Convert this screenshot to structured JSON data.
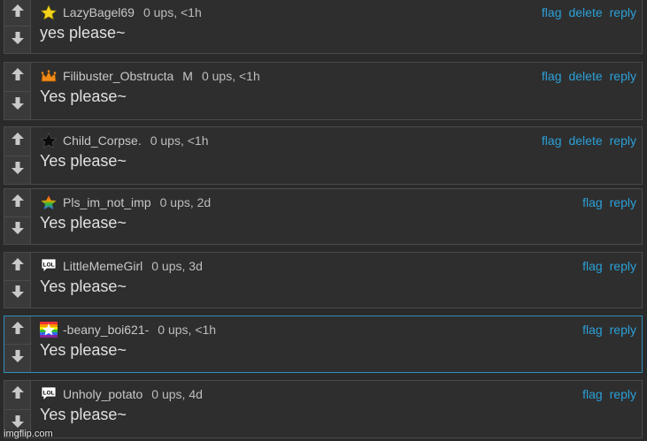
{
  "colors": {
    "link": "#2ba0d8",
    "highlight_border": "#2f8fb8"
  },
  "comments": [
    {
      "badge": "yellow-star-icon",
      "username": "LazyBagel69",
      "mod": "",
      "stats": "0 ups, <1h",
      "text": "yes please~",
      "actions": [
        "flag",
        "delete",
        "reply"
      ]
    },
    {
      "badge": "orange-crown-icon",
      "username": "Filibuster_Obstructa",
      "mod": "M",
      "stats": "0 ups, <1h",
      "text": "Yes please~",
      "actions": [
        "flag",
        "delete",
        "reply"
      ]
    },
    {
      "badge": "black-star-icon",
      "username": "Child_Corpse.",
      "mod": "",
      "stats": "0 ups, <1h",
      "text": "Yes please~",
      "actions": [
        "flag",
        "delete",
        "reply"
      ]
    },
    {
      "badge": "rainbow-star-icon",
      "username": "Pls_im_not_imp",
      "mod": "",
      "stats": "0 ups, 2d",
      "text": "Yes please~",
      "actions": [
        "flag",
        "reply"
      ]
    },
    {
      "badge": "lol-speech-icon",
      "username": "LittleMemeGirl",
      "mod": "",
      "stats": "0 ups, 3d",
      "text": "Yes please~",
      "actions": [
        "flag",
        "reply"
      ]
    },
    {
      "badge": "rainbow-flag-star-icon",
      "username": "-beany_boi621-",
      "mod": "",
      "stats": "0 ups, <1h",
      "text": "Yes please~",
      "actions": [
        "flag",
        "reply"
      ]
    },
    {
      "badge": "lol-speech-icon",
      "username": "Unholy_potato",
      "mod": "",
      "stats": "0 ups, 4d",
      "text": "Yes please~",
      "actions": [
        "flag",
        "reply"
      ]
    }
  ],
  "watermark": "imgflip.com"
}
